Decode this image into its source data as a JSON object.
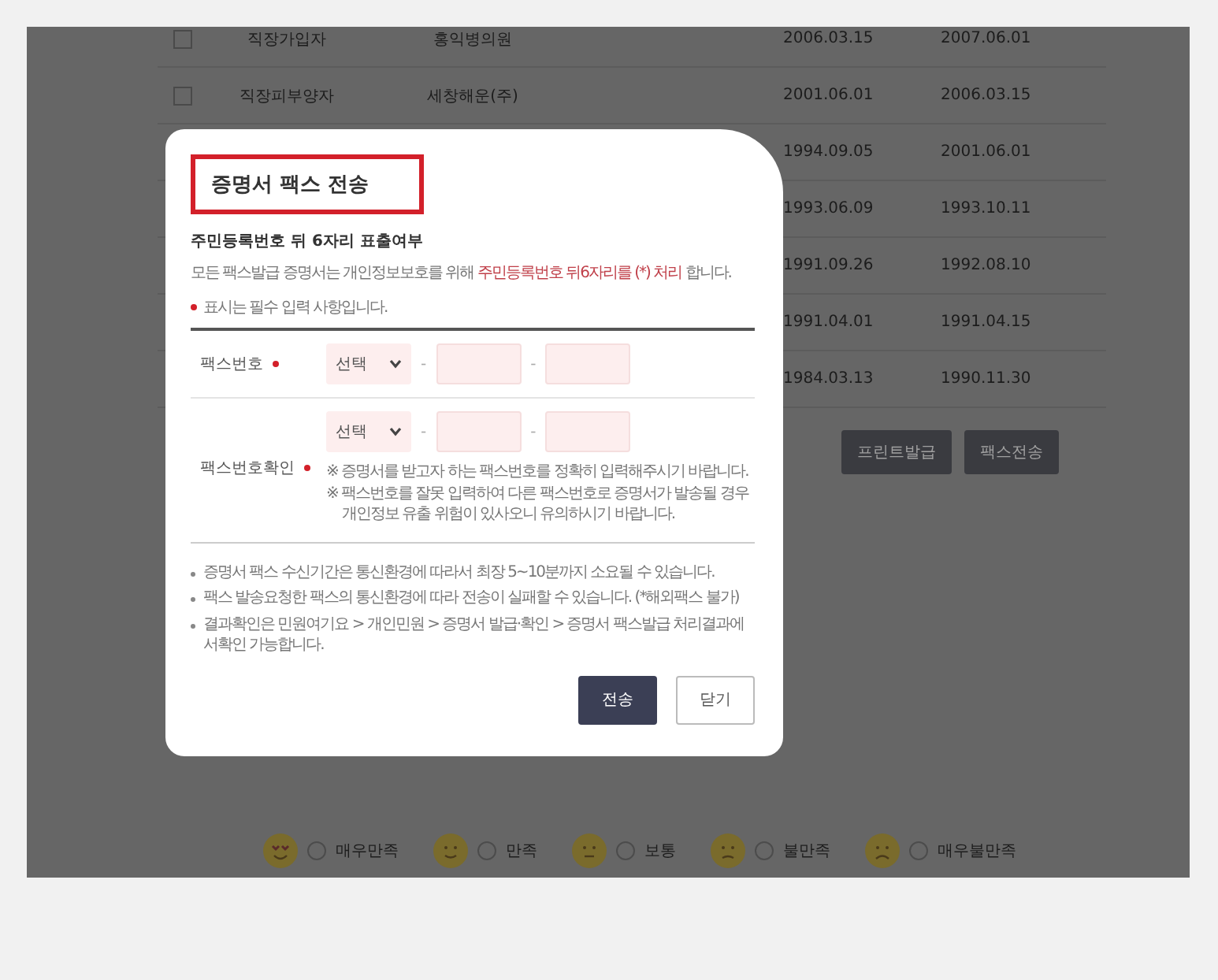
{
  "background_table": {
    "rows": [
      {
        "checked": false,
        "column_1": "직장가입자",
        "column_2": "홍익병의원",
        "column_3": "2006.03.15",
        "column_4": "2007.06.01"
      },
      {
        "checked": false,
        "column_1": "직장피부양자",
        "column_2": "세창해운(주)",
        "column_3": "2001.06.01",
        "column_4": "2006.03.15"
      },
      {
        "column_3": "1994.09.05",
        "column_4": "2001.06.01"
      },
      {
        "column_3": "1993.06.09",
        "column_4": "1993.10.11"
      },
      {
        "column_3": "1991.09.26",
        "column_4": "1992.08.10"
      },
      {
        "column_3": "1991.04.01",
        "column_4": "1991.04.15"
      },
      {
        "column_3": "1984.03.13",
        "column_4": "1990.11.30"
      }
    ]
  },
  "background_buttons": [
    "프린트발급",
    "팩스전송"
  ],
  "satisfaction": [
    {
      "label": "매우만족",
      "selected": false
    },
    {
      "label": "만족",
      "selected": false
    },
    {
      "label": "보통",
      "selected": false
    },
    {
      "label": "불만족",
      "selected": false
    },
    {
      "label": "매우불만족",
      "selected": false
    }
  ],
  "dialog": {
    "title": "증명서 팩스 전송",
    "subheading": "주민등록번호 뒤 6자리 표출여부",
    "notice": [
      {
        "text": "모든 팩스발급 증명서는 개인정보보호를 위해 ",
        "highlight": false
      },
      {
        "text": "주민등록번호 뒤6자리를 (*) 처리",
        "highlight": true
      },
      {
        "text": " 합니다.",
        "highlight": false
      }
    ],
    "required_note": "표시는 필수 입력 사항입니다.",
    "fields": [
      {
        "label": "팩스번호",
        "required": true,
        "select": "선택",
        "separators": [
          "-",
          "-"
        ]
      },
      {
        "label": "팩스번호확인",
        "required": true,
        "select": "선택",
        "separators": [
          "-",
          "-"
        ],
        "notes": [
          "※ 증명서를 받고자 하는 팩스번호를 정확히 입력해주시기 바랍니다.",
          "※ 팩스번호를 잘못 입력하여 다른 팩스번호로 증명서가 발송될 경우 개인정보 유출 위험이 있사오니 유의하시기 바랍니다."
        ]
      }
    ],
    "info": [
      "증명서 팩스 수신기간은 통신환경에 따라서 최장 5~10분까지 소요될 수 있습니다.",
      "팩스 발송요청한 팩스의 통신환경에 따라 전송이 실패할 수 있습니다. (*해외팩스 불가)",
      "결과확인은 민원여기요 > 개인민원 > 증명서 발급·확인 > 증명서 팩스발급 처리결과에서확인 가능합니다."
    ],
    "buttons": [
      {
        "label": "전송",
        "kind": "primary"
      },
      {
        "label": "닫기",
        "kind": "secondary"
      }
    ]
  }
}
